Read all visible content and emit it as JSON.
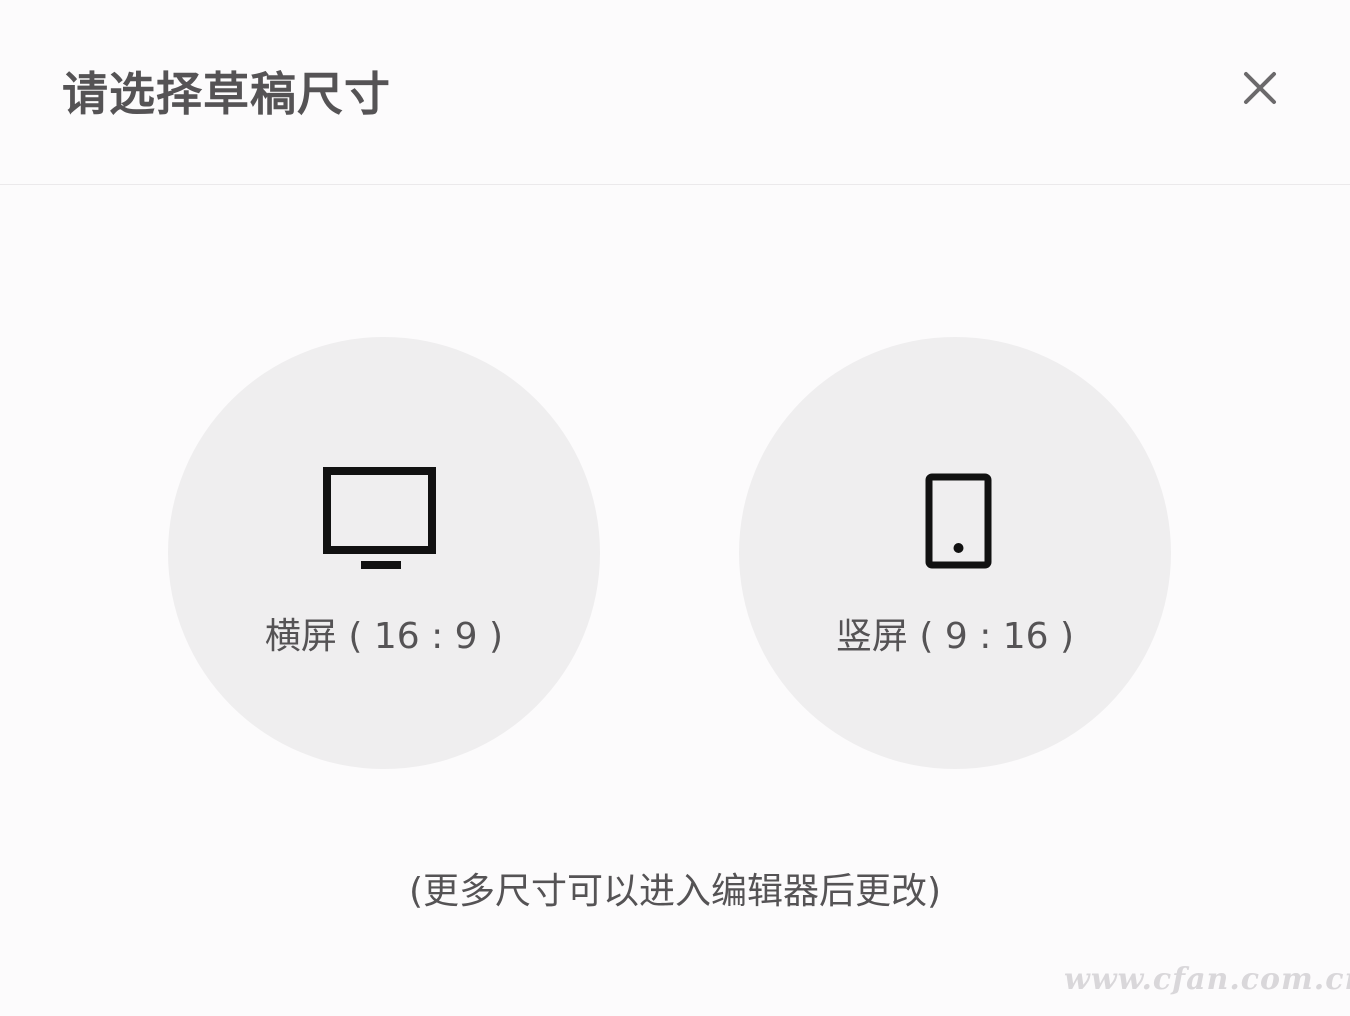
{
  "dialog": {
    "title": "请选择草稿尺寸",
    "close_icon": "close-icon"
  },
  "options": [
    {
      "label": "横屏 ( 16 : 9 )",
      "icon": "monitor-icon"
    },
    {
      "label": "竖屏 ( 9 : 16 )",
      "icon": "phone-icon"
    }
  ],
  "hint": "(更多尺寸可以进入编辑器后更改)",
  "watermark": "www.cfan.com.cn",
  "colors": {
    "background": "#fcfbfc",
    "option_circle": "#efeeef",
    "text": "#555355",
    "icon": "#111111"
  }
}
